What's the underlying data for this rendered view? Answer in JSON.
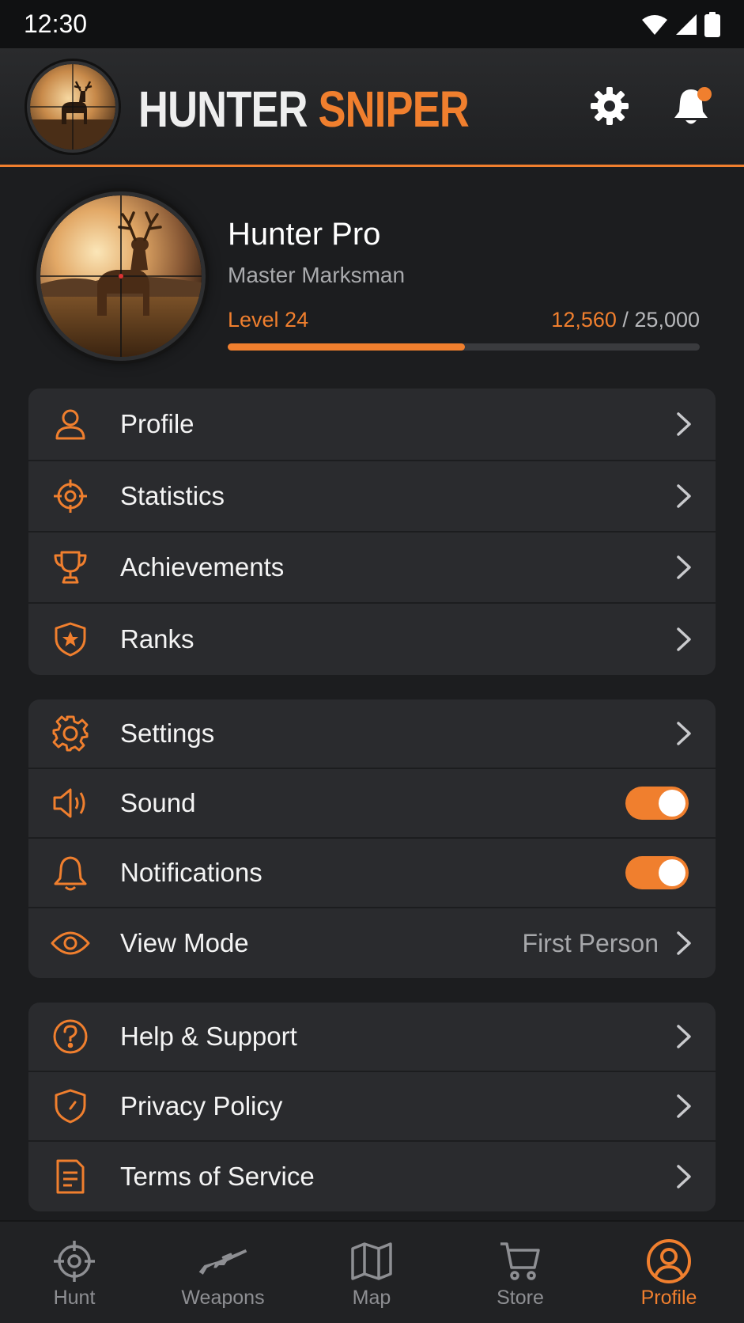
{
  "status": {
    "time": "12:30"
  },
  "header": {
    "brand_white": "HUNTER",
    "brand_orange": "SNIPER"
  },
  "profile": {
    "name": "Hunter Pro",
    "title": "Master Marksman",
    "level": "Level 24",
    "xp_current": "12,560",
    "xp_sep": " / ",
    "xp_total": "25,000",
    "xp_progress": 0.5024
  },
  "groups": [
    {
      "items": [
        {
          "label": "Profile",
          "icon": "user-icon"
        },
        {
          "label": "Statistics",
          "icon": "crosshair-icon"
        },
        {
          "label": "Achievements",
          "icon": "trophy-icon"
        },
        {
          "label": "Ranks",
          "icon": "shield-star-icon"
        }
      ]
    },
    {
      "items": [
        {
          "label": "Settings",
          "icon": "gear-icon"
        },
        {
          "label": "Sound",
          "icon": "speaker-icon",
          "toggle": true
        },
        {
          "label": "Notifications",
          "icon": "bell-icon",
          "toggle": true
        },
        {
          "label": "View Mode",
          "icon": "eye-icon",
          "value": "First Person"
        }
      ]
    },
    {
      "items": [
        {
          "label": "Help & Support",
          "icon": "question-circle-icon"
        },
        {
          "label": "Privacy Policy",
          "icon": "shield-icon"
        },
        {
          "label": "Terms of Service",
          "icon": "document-icon"
        }
      ]
    }
  ],
  "tabs": [
    {
      "label": "Hunt",
      "icon": "crosshair-icon"
    },
    {
      "label": "Weapons",
      "icon": "rifle-icon"
    },
    {
      "label": "Map",
      "icon": "map-icon"
    },
    {
      "label": "Store",
      "icon": "cart-icon"
    },
    {
      "label": "Profile",
      "icon": "user-circle-icon",
      "active": true
    }
  ],
  "colors": {
    "accent": "#f07f2e",
    "background": "#1c1d1f",
    "card": "#2a2b2e"
  }
}
